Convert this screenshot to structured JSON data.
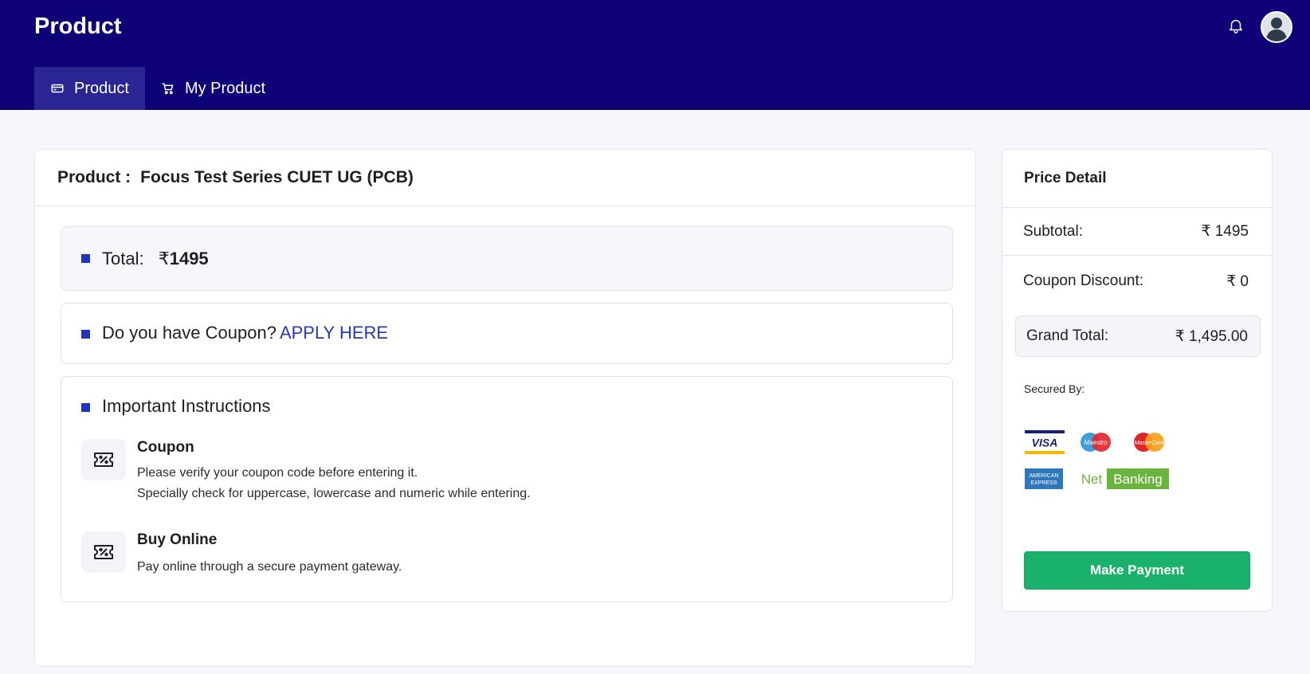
{
  "header": {
    "title": "Product",
    "bell_icon": "bell-icon",
    "avatar": "user-avatar"
  },
  "tabs": [
    {
      "label": "Product",
      "icon": "card-icon",
      "active": true
    },
    {
      "label": "My Product",
      "icon": "cart-icon",
      "active": false
    }
  ],
  "product": {
    "heading_label": "Product :",
    "name": "Focus Test Series CUET UG (PCB)"
  },
  "total": {
    "label": "Total:",
    "currency": "₹",
    "amount": "1495"
  },
  "coupon": {
    "question": "Do you have Coupon?",
    "link_label": "APPLY HERE"
  },
  "instructions": {
    "title": "Important Instructions",
    "items": [
      {
        "title": "Coupon",
        "icon": "coupon-ticket-icon",
        "lines": [
          "Please verify your coupon code before entering it.",
          "Specially check for uppercase, lowercase and numeric while entering."
        ]
      },
      {
        "title": "Buy Online",
        "icon": "coupon-ticket-icon",
        "lines": [
          "Pay online through a secure payment gateway."
        ]
      }
    ]
  },
  "price_detail": {
    "title": "Price Detail",
    "subtotal_label": "Subtotal:",
    "subtotal_value": "₹ 1495",
    "discount_label": "Coupon Discount:",
    "discount_value": "₹ 0",
    "grand_label": "Grand Total:",
    "grand_value": "₹ 1,495.00",
    "secured_label": "Secured By:",
    "payment_logos": {
      "visa": "VISA",
      "maestro": "Maestro",
      "mastercard": "MasterCard",
      "amex_line1": "AMERICAN",
      "amex_line2": "EXPRESS",
      "netbanking_part1": "Net",
      "netbanking_part2": "Banking"
    },
    "pay_button": "Make Payment"
  },
  "colors": {
    "header_bg": "#0e0077",
    "active_tab": "#2b2593",
    "accent_blue": "#2637b8",
    "pay_green": "#1ab26b"
  }
}
